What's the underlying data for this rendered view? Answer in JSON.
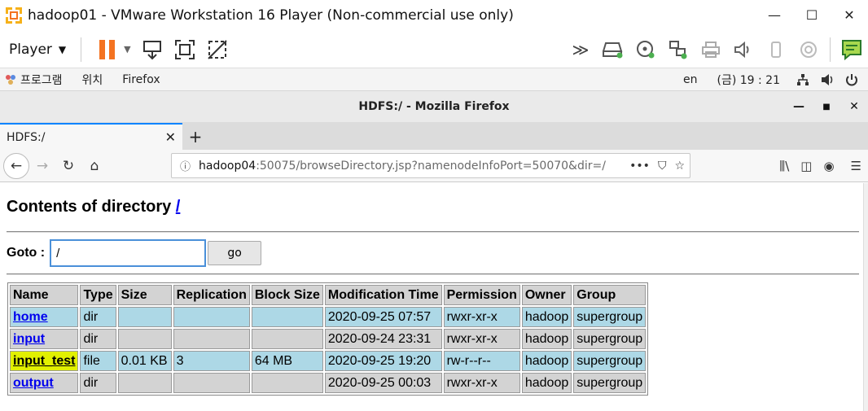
{
  "vmware": {
    "title": "hadoop01 - VMware Workstation 16 Player (Non-commercial use only)",
    "player_menu": "Player"
  },
  "gnome": {
    "apps": "프로그램",
    "places": "위치",
    "firefox": "Firefox",
    "lang": "en",
    "clock": "(금) 19 : 21"
  },
  "firefox": {
    "window_title": "HDFS:/ - Mozilla Firefox",
    "tab_label": "HDFS:/",
    "url_host": "hadoop04",
    "url_rest": ":50075/browseDirectory.jsp?namenodeInfoPort=50070&dir=/"
  },
  "page": {
    "heading": "Contents of directory ",
    "heading_link": "/",
    "goto_label": "Goto :",
    "goto_value": "/",
    "go_button": "go"
  },
  "table": {
    "headers": [
      "Name",
      "Type",
      "Size",
      "Replication",
      "Block Size",
      "Modification Time",
      "Permission",
      "Owner",
      "Group"
    ],
    "rows": [
      {
        "name": "home",
        "type": "dir",
        "size": "",
        "replication": "",
        "block_size": "",
        "mtime": "2020-09-25 07:57",
        "permission": "rwxr-xr-x",
        "owner": "hadoop",
        "group": "supergroup"
      },
      {
        "name": "input",
        "type": "dir",
        "size": "",
        "replication": "",
        "block_size": "",
        "mtime": "2020-09-24 23:31",
        "permission": "rwxr-xr-x",
        "owner": "hadoop",
        "group": "supergroup"
      },
      {
        "name": "input_test",
        "type": "file",
        "size": "0.01 KB",
        "replication": "3",
        "block_size": "64 MB",
        "mtime": "2020-09-25 19:20",
        "permission": "rw-r--r--",
        "owner": "hadoop",
        "group": "supergroup"
      },
      {
        "name": "output",
        "type": "dir",
        "size": "",
        "replication": "",
        "block_size": "",
        "mtime": "2020-09-25 00:03",
        "permission": "rwxr-xr-x",
        "owner": "hadoop",
        "group": "supergroup"
      }
    ]
  },
  "colors": {
    "row_light": "#add8e6",
    "row_gray": "#d3d3d3",
    "highlight": "#e1f000",
    "vm_orange": "#f47321"
  }
}
